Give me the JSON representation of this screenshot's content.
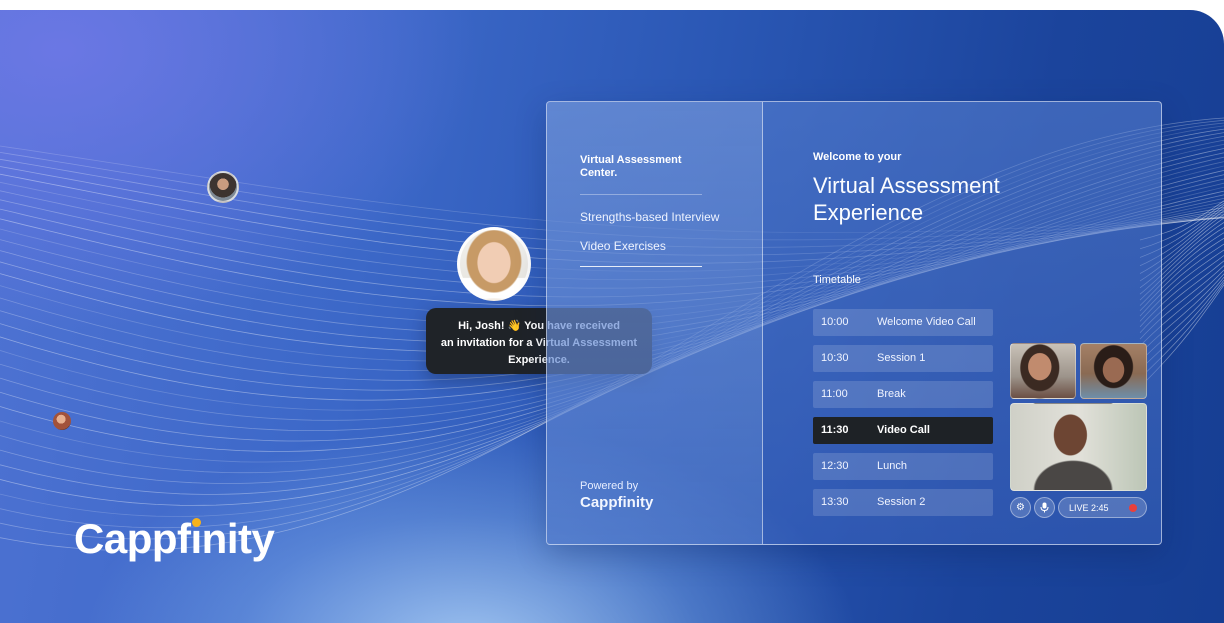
{
  "colors": {
    "bubble_bg": "#1f2328",
    "active_row_bg": "#1e2226",
    "logo_dot": "#f5b21c",
    "record_dot": "#e8403c"
  },
  "chat": {
    "message_line1": "Hi, Josh! 👋 You have received",
    "message_line2": "an invitation for a Virtual Assessment",
    "message_line3": "Experience."
  },
  "brand": {
    "logo_text_before": "Cappf",
    "logo_text_i": "ı",
    "logo_text_after": "nity"
  },
  "sidebar": {
    "title": "Virtual Assessment Center.",
    "items": [
      {
        "label": "Strengths-based Interview"
      },
      {
        "label": "Video Exercises"
      }
    ],
    "powered_by_label": "Powered by",
    "powered_by_brand": "Cappfinity"
  },
  "main": {
    "welcome_small": "Welcome to your",
    "welcome_title": "Virtual Assessment Experience",
    "timetable_label": "Timetable",
    "timetable": [
      {
        "time": "10:00",
        "name": "Welcome Video Call",
        "active": false
      },
      {
        "time": "10:30",
        "name": "Session 1",
        "active": false
      },
      {
        "time": "11:00",
        "name": "Break",
        "active": false
      },
      {
        "time": "11:30",
        "name": "Video Call",
        "active": true
      },
      {
        "time": "12:30",
        "name": "Lunch",
        "active": false
      },
      {
        "time": "13:30",
        "name": "Session 2",
        "active": false
      }
    ]
  },
  "video_call": {
    "live_label": "LIVE 2:45",
    "icons": {
      "settings": "gear-icon",
      "microphone": "microphone-icon",
      "record": "record-icon"
    }
  }
}
